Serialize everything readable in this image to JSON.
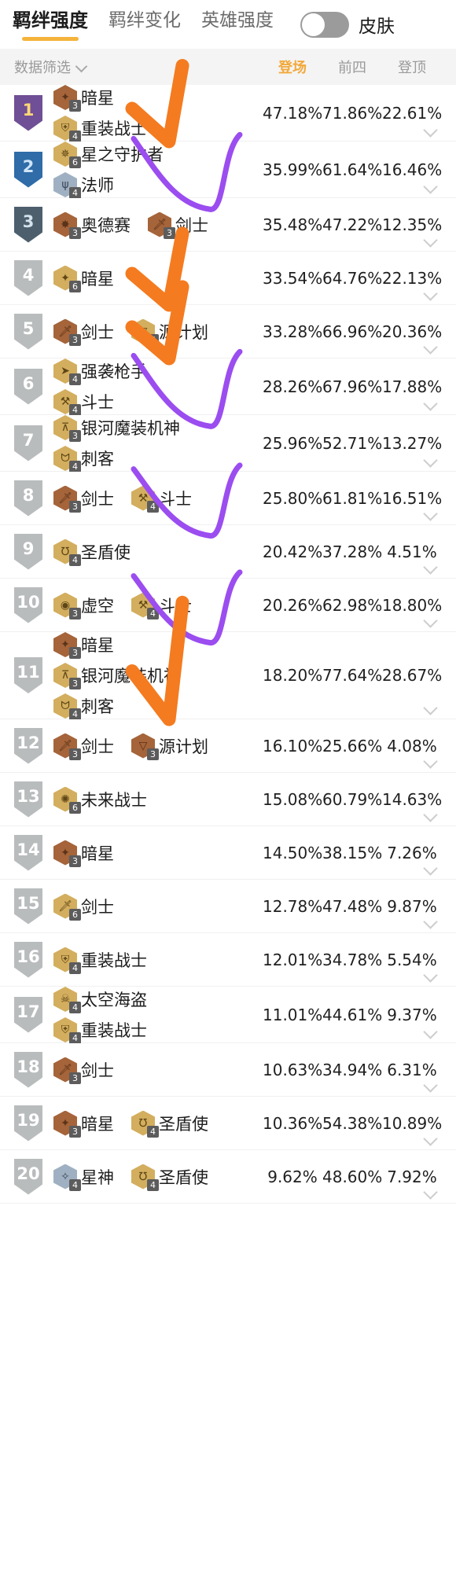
{
  "topbar": {
    "tabs": [
      {
        "label": "羁绊强度",
        "active": true
      },
      {
        "label": "羁绊变化",
        "active": false
      },
      {
        "label": "英雄强度",
        "active": false
      }
    ],
    "toggle": {
      "name": "skin-toggle",
      "state": "off"
    },
    "toggle_label": "皮肤"
  },
  "colheader": {
    "filter_label": "数据筛选",
    "filter_icon": "chevron-down-icon",
    "columns": [
      {
        "label": "登场",
        "selected": true
      },
      {
        "label": "前四",
        "selected": false
      },
      {
        "label": "登顶",
        "selected": false
      }
    ]
  },
  "table": {
    "rows": [
      {
        "rank": "1",
        "rank_tier": "r1",
        "traits": [
          [
            {
              "name": "暗星",
              "count": "3",
              "tier": "bronze",
              "glyph": "✦"
            }
          ],
          [
            {
              "name": "重装战士",
              "count": "4",
              "tier": "gold",
              "glyph": "⛨"
            }
          ]
        ],
        "appear": "47.18%",
        "top4": "71.86%",
        "first": "22.61%"
      },
      {
        "rank": "2",
        "rank_tier": "r2",
        "traits": [
          [
            {
              "name": "星之守护者",
              "count": "6",
              "tier": "gold",
              "glyph": "✵"
            }
          ],
          [
            {
              "name": "法师",
              "count": "4",
              "tier": "silver",
              "glyph": "ψ"
            }
          ]
        ],
        "appear": "35.99%",
        "top4": "61.64%",
        "first": "16.46%"
      },
      {
        "rank": "3",
        "rank_tier": "r3",
        "traits": [
          [
            {
              "name": "奥德赛",
              "count": "3",
              "tier": "bronze",
              "glyph": "✸"
            },
            {
              "name": "剑士",
              "count": "3",
              "tier": "bronze",
              "glyph": "🗡"
            }
          ]
        ],
        "appear": "35.48%",
        "top4": "47.22%",
        "first": "12.35%"
      },
      {
        "rank": "4",
        "rank_tier": "",
        "traits": [
          [
            {
              "name": "暗星",
              "count": "6",
              "tier": "gold",
              "glyph": "✦"
            }
          ]
        ],
        "appear": "33.54%",
        "top4": "64.76%",
        "first": "22.13%"
      },
      {
        "rank": "5",
        "rank_tier": "",
        "traits": [
          [
            {
              "name": "剑士",
              "count": "3",
              "tier": "bronze",
              "glyph": "🗡"
            },
            {
              "name": "源计划",
              "count": "6",
              "tier": "gold",
              "glyph": "▽"
            }
          ]
        ],
        "appear": "33.28%",
        "top4": "66.96%",
        "first": "20.36%"
      },
      {
        "rank": "6",
        "rank_tier": "",
        "traits": [
          [
            {
              "name": "强袭枪手",
              "count": "4",
              "tier": "gold",
              "glyph": "➤"
            }
          ],
          [
            {
              "name": "斗士",
              "count": "4",
              "tier": "gold",
              "glyph": "⚒"
            }
          ]
        ],
        "appear": "28.26%",
        "top4": "67.96%",
        "first": "17.88%"
      },
      {
        "rank": "7",
        "rank_tier": "",
        "traits": [
          [
            {
              "name": "银河魔装机神",
              "count": "3",
              "tier": "gold",
              "glyph": "⊼"
            }
          ],
          [
            {
              "name": "刺客",
              "count": "4",
              "tier": "gold",
              "glyph": "ᗢ"
            }
          ]
        ],
        "appear": "25.96%",
        "top4": "52.71%",
        "first": "13.27%"
      },
      {
        "rank": "8",
        "rank_tier": "",
        "traits": [
          [
            {
              "name": "剑士",
              "count": "3",
              "tier": "bronze",
              "glyph": "🗡"
            },
            {
              "name": "斗士",
              "count": "4",
              "tier": "gold",
              "glyph": "⚒"
            }
          ]
        ],
        "appear": "25.80%",
        "top4": "61.81%",
        "first": "16.51%"
      },
      {
        "rank": "9",
        "rank_tier": "",
        "traits": [
          [
            {
              "name": "圣盾使",
              "count": "4",
              "tier": "gold",
              "glyph": "℧"
            }
          ]
        ],
        "appear": "20.42%",
        "top4": "37.28%",
        "first": "4.51%"
      },
      {
        "rank": "10",
        "rank_tier": "",
        "traits": [
          [
            {
              "name": "虚空",
              "count": "3",
              "tier": "gold",
              "glyph": "◉"
            },
            {
              "name": "斗士",
              "count": "4",
              "tier": "gold",
              "glyph": "⚒"
            }
          ]
        ],
        "appear": "20.26%",
        "top4": "62.98%",
        "first": "18.80%"
      },
      {
        "rank": "11",
        "rank_tier": "",
        "traits": [
          [
            {
              "name": "暗星",
              "count": "3",
              "tier": "bronze",
              "glyph": "✦"
            }
          ],
          [
            {
              "name": "银河魔装机神",
              "count": "3",
              "tier": "gold",
              "glyph": "⊼"
            }
          ],
          [
            {
              "name": "刺客",
              "count": "4",
              "tier": "gold",
              "glyph": "ᗢ"
            }
          ]
        ],
        "appear": "18.20%",
        "top4": "77.64%",
        "first": "28.67%"
      },
      {
        "rank": "12",
        "rank_tier": "",
        "traits": [
          [
            {
              "name": "剑士",
              "count": "3",
              "tier": "bronze",
              "glyph": "🗡"
            },
            {
              "name": "源计划",
              "count": "3",
              "tier": "bronze",
              "glyph": "▽"
            }
          ]
        ],
        "appear": "16.10%",
        "top4": "25.66%",
        "first": "4.08%"
      },
      {
        "rank": "13",
        "rank_tier": "",
        "traits": [
          [
            {
              "name": "未来战士",
              "count": "6",
              "tier": "gold",
              "glyph": "✺"
            }
          ]
        ],
        "appear": "15.08%",
        "top4": "60.79%",
        "first": "14.63%"
      },
      {
        "rank": "14",
        "rank_tier": "",
        "traits": [
          [
            {
              "name": "暗星",
              "count": "3",
              "tier": "bronze",
              "glyph": "✦"
            }
          ]
        ],
        "appear": "14.50%",
        "top4": "38.15%",
        "first": "7.26%"
      },
      {
        "rank": "15",
        "rank_tier": "",
        "traits": [
          [
            {
              "name": "剑士",
              "count": "6",
              "tier": "gold",
              "glyph": "🗡"
            }
          ]
        ],
        "appear": "12.78%",
        "top4": "47.48%",
        "first": "9.87%"
      },
      {
        "rank": "16",
        "rank_tier": "",
        "traits": [
          [
            {
              "name": "重装战士",
              "count": "4",
              "tier": "gold",
              "glyph": "⛨"
            }
          ]
        ],
        "appear": "12.01%",
        "top4": "34.78%",
        "first": "5.54%"
      },
      {
        "rank": "17",
        "rank_tier": "",
        "traits": [
          [
            {
              "name": "太空海盗",
              "count": "4",
              "tier": "gold",
              "glyph": "☠"
            }
          ],
          [
            {
              "name": "重装战士",
              "count": "4",
              "tier": "gold",
              "glyph": "⛨"
            }
          ]
        ],
        "appear": "11.01%",
        "top4": "44.61%",
        "first": "9.37%"
      },
      {
        "rank": "18",
        "rank_tier": "",
        "traits": [
          [
            {
              "name": "剑士",
              "count": "3",
              "tier": "bronze",
              "glyph": "🗡"
            }
          ]
        ],
        "appear": "10.63%",
        "top4": "34.94%",
        "first": "6.31%"
      },
      {
        "rank": "19",
        "rank_tier": "",
        "traits": [
          [
            {
              "name": "暗星",
              "count": "3",
              "tier": "bronze",
              "glyph": "✦"
            },
            {
              "name": "圣盾使",
              "count": "4",
              "tier": "gold",
              "glyph": "℧"
            }
          ]
        ],
        "appear": "10.36%",
        "top4": "54.38%",
        "first": "10.89%"
      },
      {
        "rank": "20",
        "rank_tier": "",
        "traits": [
          [
            {
              "name": "星神",
              "count": "4",
              "tier": "silver",
              "glyph": "✧"
            },
            {
              "name": "圣盾使",
              "count": "4",
              "tier": "gold",
              "glyph": "℧"
            }
          ]
        ],
        "appear": "9.62%",
        "top4": "48.60%",
        "first": "7.92%"
      }
    ]
  },
  "annotations": {
    "checkmark_color": "#F47B20",
    "curve_color": "#9B4DF0",
    "marks": [
      {
        "kind": "checkmark",
        "target_rank": "1"
      },
      {
        "kind": "curve",
        "target_rank": "2"
      },
      {
        "kind": "checkmark",
        "target_rank": "4"
      },
      {
        "kind": "checkmark",
        "target_rank": "5"
      },
      {
        "kind": "curve",
        "target_rank": "6"
      },
      {
        "kind": "curve",
        "target_rank": "8"
      },
      {
        "kind": "curve",
        "target_rank": "10"
      },
      {
        "kind": "checkmark",
        "target_rank": "11"
      }
    ]
  }
}
